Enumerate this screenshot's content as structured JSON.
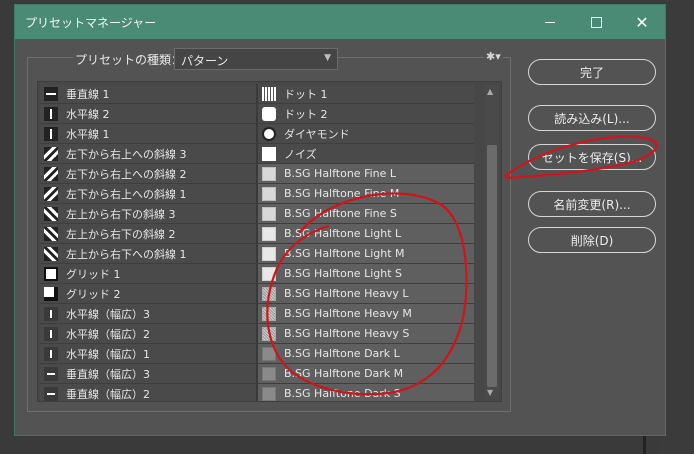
{
  "window": {
    "title": "プリセットマネージャー"
  },
  "preset_type": {
    "label": "プリセットの種類：",
    "selected": "パターン"
  },
  "buttons": {
    "done": "完了",
    "load": "読み込み(L)...",
    "save": "セットを保存(S)...",
    "rename": "名前変更(R)...",
    "delete": "削除(D)"
  },
  "left_column": [
    {
      "label": "垂直線 1",
      "thumb": "hline"
    },
    {
      "label": "水平線 2",
      "thumb": "vline"
    },
    {
      "label": "水平線 1",
      "thumb": "vline"
    },
    {
      "label": "左下から右上への斜線 3",
      "thumb": "diag-up"
    },
    {
      "label": "左下から右上への斜線 2",
      "thumb": "diag-up"
    },
    {
      "label": "左下から右上への斜線 1",
      "thumb": "diag-up"
    },
    {
      "label": "左上から右下の斜線 3",
      "thumb": "diag-dn"
    },
    {
      "label": "左上から右下の斜線 2",
      "thumb": "diag-dn"
    },
    {
      "label": "左上から右下への斜線 1",
      "thumb": "diag-dn"
    },
    {
      "label": "グリッド 1",
      "thumb": "grid"
    },
    {
      "label": "グリッド 2",
      "thumb": "grid2"
    },
    {
      "label": "水平線（幅広）3",
      "thumb": "vsmall"
    },
    {
      "label": "水平線（幅広）2",
      "thumb": "vsmall"
    },
    {
      "label": "水平線（幅広）1",
      "thumb": "vsmall"
    },
    {
      "label": "垂直線（幅広）3",
      "thumb": "hsmall"
    },
    {
      "label": "垂直線（幅広）2",
      "thumb": "hsmall"
    }
  ],
  "right_column": [
    {
      "label": "ドット 1",
      "thumb": "dot1",
      "hl": false
    },
    {
      "label": "ドット 2",
      "thumb": "dot2",
      "hl": false
    },
    {
      "label": "ダイヤモンド",
      "thumb": "diamond",
      "hl": false
    },
    {
      "label": "ノイズ",
      "thumb": "noise",
      "hl": false
    },
    {
      "label": "B.SG Halftone Fine L",
      "thumb": "fine",
      "hl": true
    },
    {
      "label": "B.SG Halftone Fine M",
      "thumb": "fine",
      "hl": true
    },
    {
      "label": "B.SG Halftone Fine S",
      "thumb": "fine",
      "hl": true
    },
    {
      "label": "B.SG Halftone Light L",
      "thumb": "light",
      "hl": true
    },
    {
      "label": "B.SG Halftone Light M",
      "thumb": "light",
      "hl": true
    },
    {
      "label": "B.SG Halftone Light S",
      "thumb": "light",
      "hl": true
    },
    {
      "label": "B.SG Halftone Heavy L",
      "thumb": "heavy",
      "hl": true
    },
    {
      "label": "B.SG Halftone Heavy M",
      "thumb": "heavy",
      "hl": true
    },
    {
      "label": "B.SG Halftone Heavy S",
      "thumb": "heavy",
      "hl": true
    },
    {
      "label": "B.SG Halftone Dark L",
      "thumb": "dark",
      "hl": true
    },
    {
      "label": "B.SG Halftone Dark M",
      "thumb": "dark",
      "hl": true
    },
    {
      "label": "B.SG Halftone Dark S",
      "thumb": "dark",
      "hl": true
    }
  ],
  "colors": {
    "titlebar": "#4a8b76",
    "dialog": "#535353",
    "annotation": "#d0141b"
  }
}
